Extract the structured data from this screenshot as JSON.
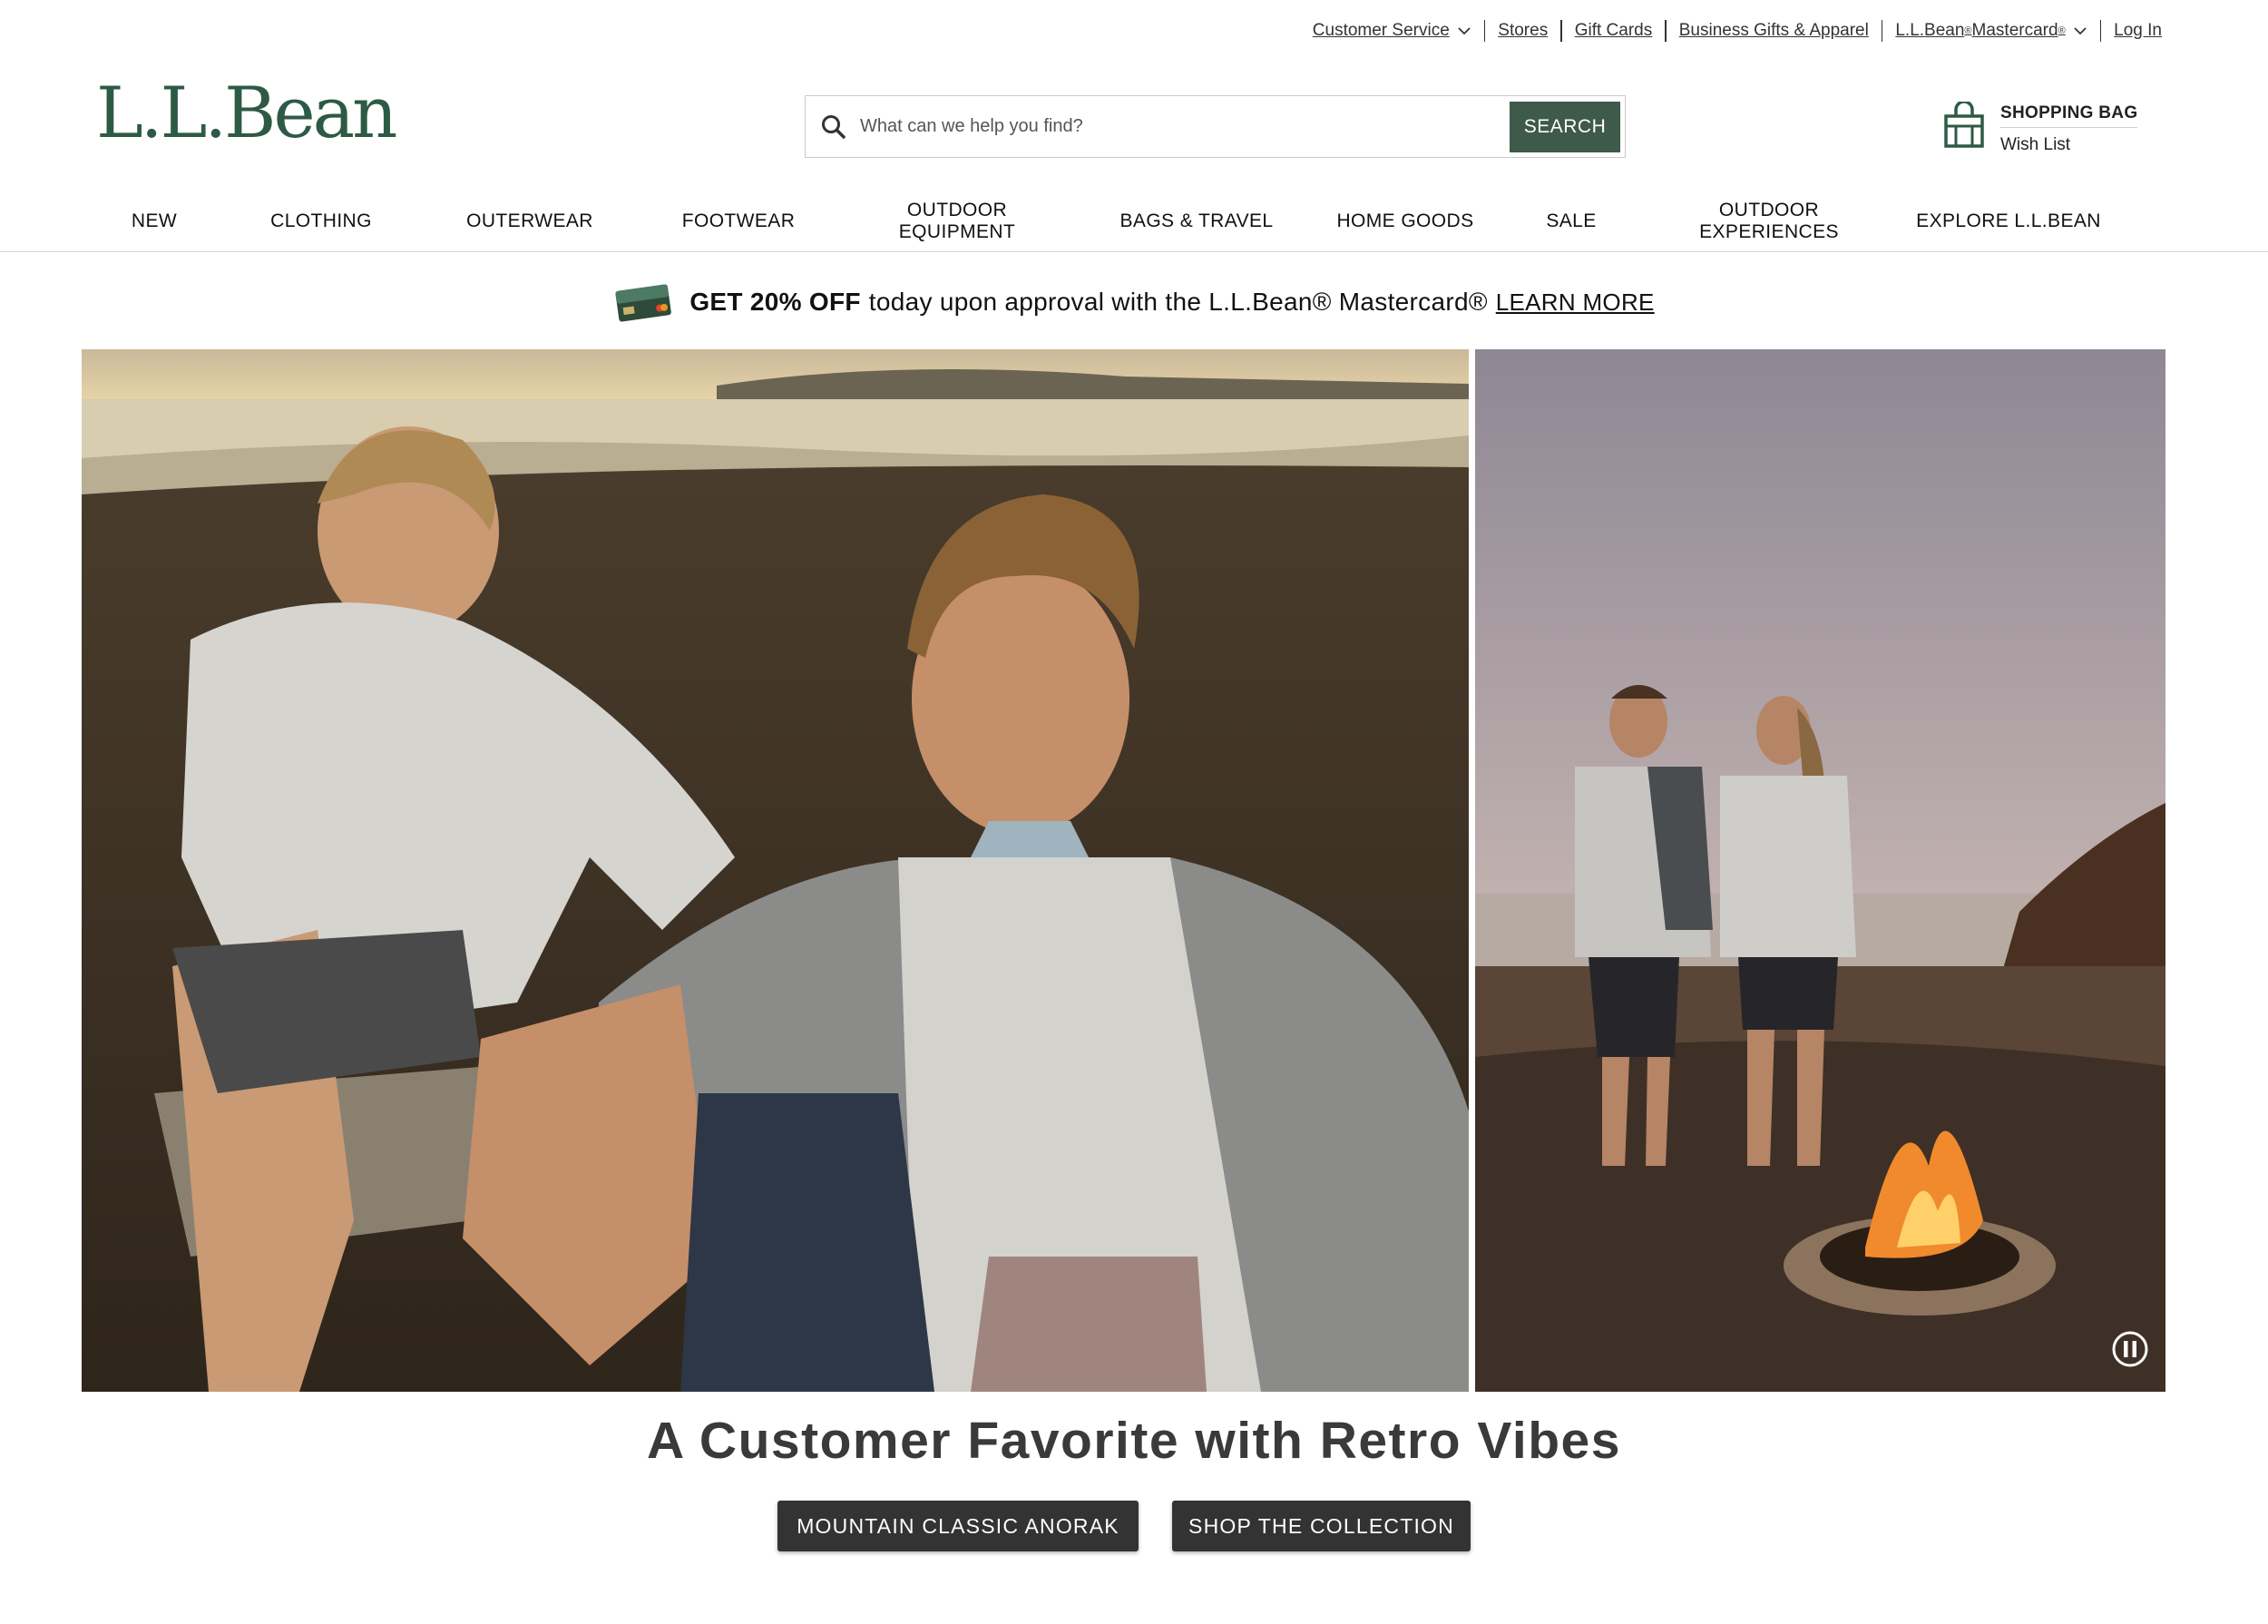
{
  "utility": {
    "customer_service": "Customer Service",
    "stores": "Stores",
    "gift_cards": "Gift Cards",
    "business_gifts": "Business Gifts & Apparel",
    "mastercard_prefix": "L.L.Bean",
    "mastercard_reg1": "®",
    "mastercard_word": " Mastercard",
    "mastercard_reg2": "®",
    "log_in": "Log In"
  },
  "header": {
    "logo": "L.L.Bean",
    "search_placeholder": "What can we help you find?",
    "search_button": "SEARCH",
    "shopping_bag": "SHOPPING BAG",
    "wish_list": "Wish List"
  },
  "nav": {
    "items": [
      {
        "label": "NEW"
      },
      {
        "label": "CLOTHING"
      },
      {
        "label": "OUTERWEAR"
      },
      {
        "label": "FOOTWEAR"
      },
      {
        "label": "OUTDOOR\nEQUIPMENT"
      },
      {
        "label": "BAGS & TRAVEL"
      },
      {
        "label": "HOME GOODS"
      },
      {
        "label": "SALE"
      },
      {
        "label": "OUTDOOR\nEXPERIENCES"
      },
      {
        "label": "EXPLORE L.L.BEAN"
      }
    ]
  },
  "promo": {
    "bold": "GET 20% OFF",
    "text": "today upon approval with the L.L.Bean® Mastercard®",
    "link": "LEARN MORE"
  },
  "hero": {
    "headline": "A Customer Favorite with Retro Vibes",
    "cta_primary": "MOUNTAIN CLASSIC ANORAK",
    "cta_secondary": "SHOP THE COLLECTION"
  },
  "colors": {
    "brand_green": "#2d5a45",
    "search_button": "#3e5a4a",
    "cta_dark": "#333333"
  },
  "icons": {
    "search": "search-icon",
    "bag": "shopping-bag-icon",
    "chevron": "chevron-down-icon",
    "card": "credit-card-icon",
    "pause": "pause-icon"
  }
}
